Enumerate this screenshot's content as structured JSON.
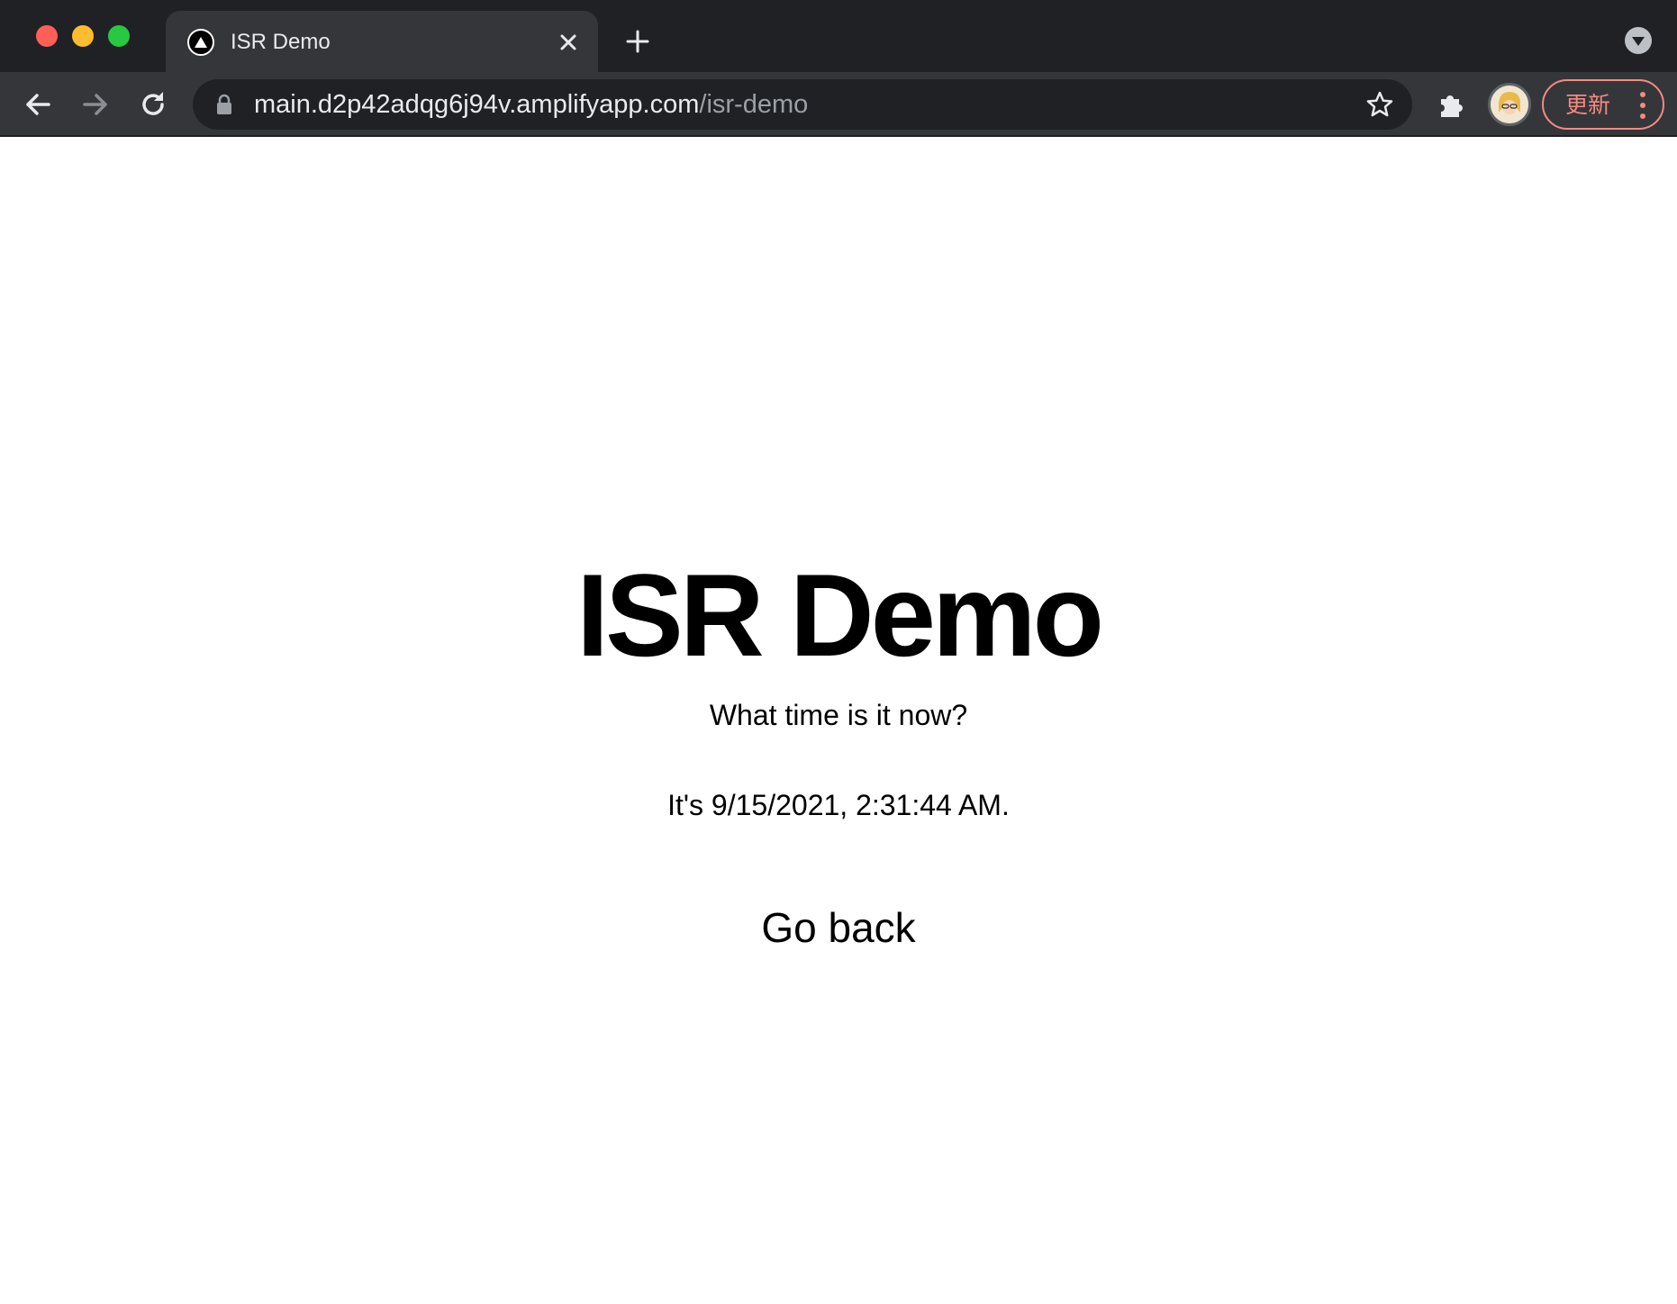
{
  "browser": {
    "tab": {
      "title": "ISR Demo",
      "favicon": "triangle-logo-icon"
    },
    "address_bar": {
      "host": "main.d2p42adqg6j94v.amplifyapp.com",
      "path": "/isr-demo"
    },
    "update_button": {
      "label": "更新"
    },
    "icons": {
      "back": "arrow-left-icon",
      "forward": "arrow-right-icon",
      "reload": "reload-icon",
      "lock": "lock-icon",
      "bookmark": "star-icon",
      "extensions": "puzzle-icon",
      "new_tab": "plus-icon",
      "close_tab": "close-icon",
      "tab_search": "chevron-down-icon",
      "menu": "kebab-menu-icon"
    },
    "colors": {
      "chrome_dark": "#202124",
      "chrome_mid": "#35363a",
      "update_accent": "#f28b82"
    }
  },
  "page": {
    "heading": "ISR Demo",
    "question": "What time is it now?",
    "timestamp": "It's 9/15/2021, 2:31:44 AM.",
    "back_link": "Go back"
  }
}
